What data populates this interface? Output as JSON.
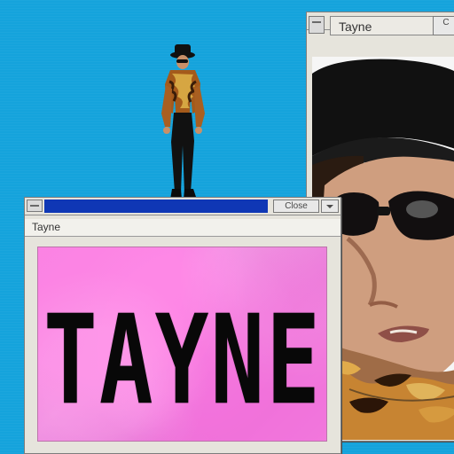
{
  "desktop": {
    "background_color": "#15a3dc"
  },
  "windows": {
    "photo": {
      "title": "Tayne",
      "close_label": "C",
      "icon": "photo-portrait"
    },
    "main": {
      "title": "Tayne",
      "close_label": "Close",
      "dropdown_icon": "chevron-down-icon",
      "content_text": "TAYNE",
      "panel_color": "#ee82de"
    }
  }
}
